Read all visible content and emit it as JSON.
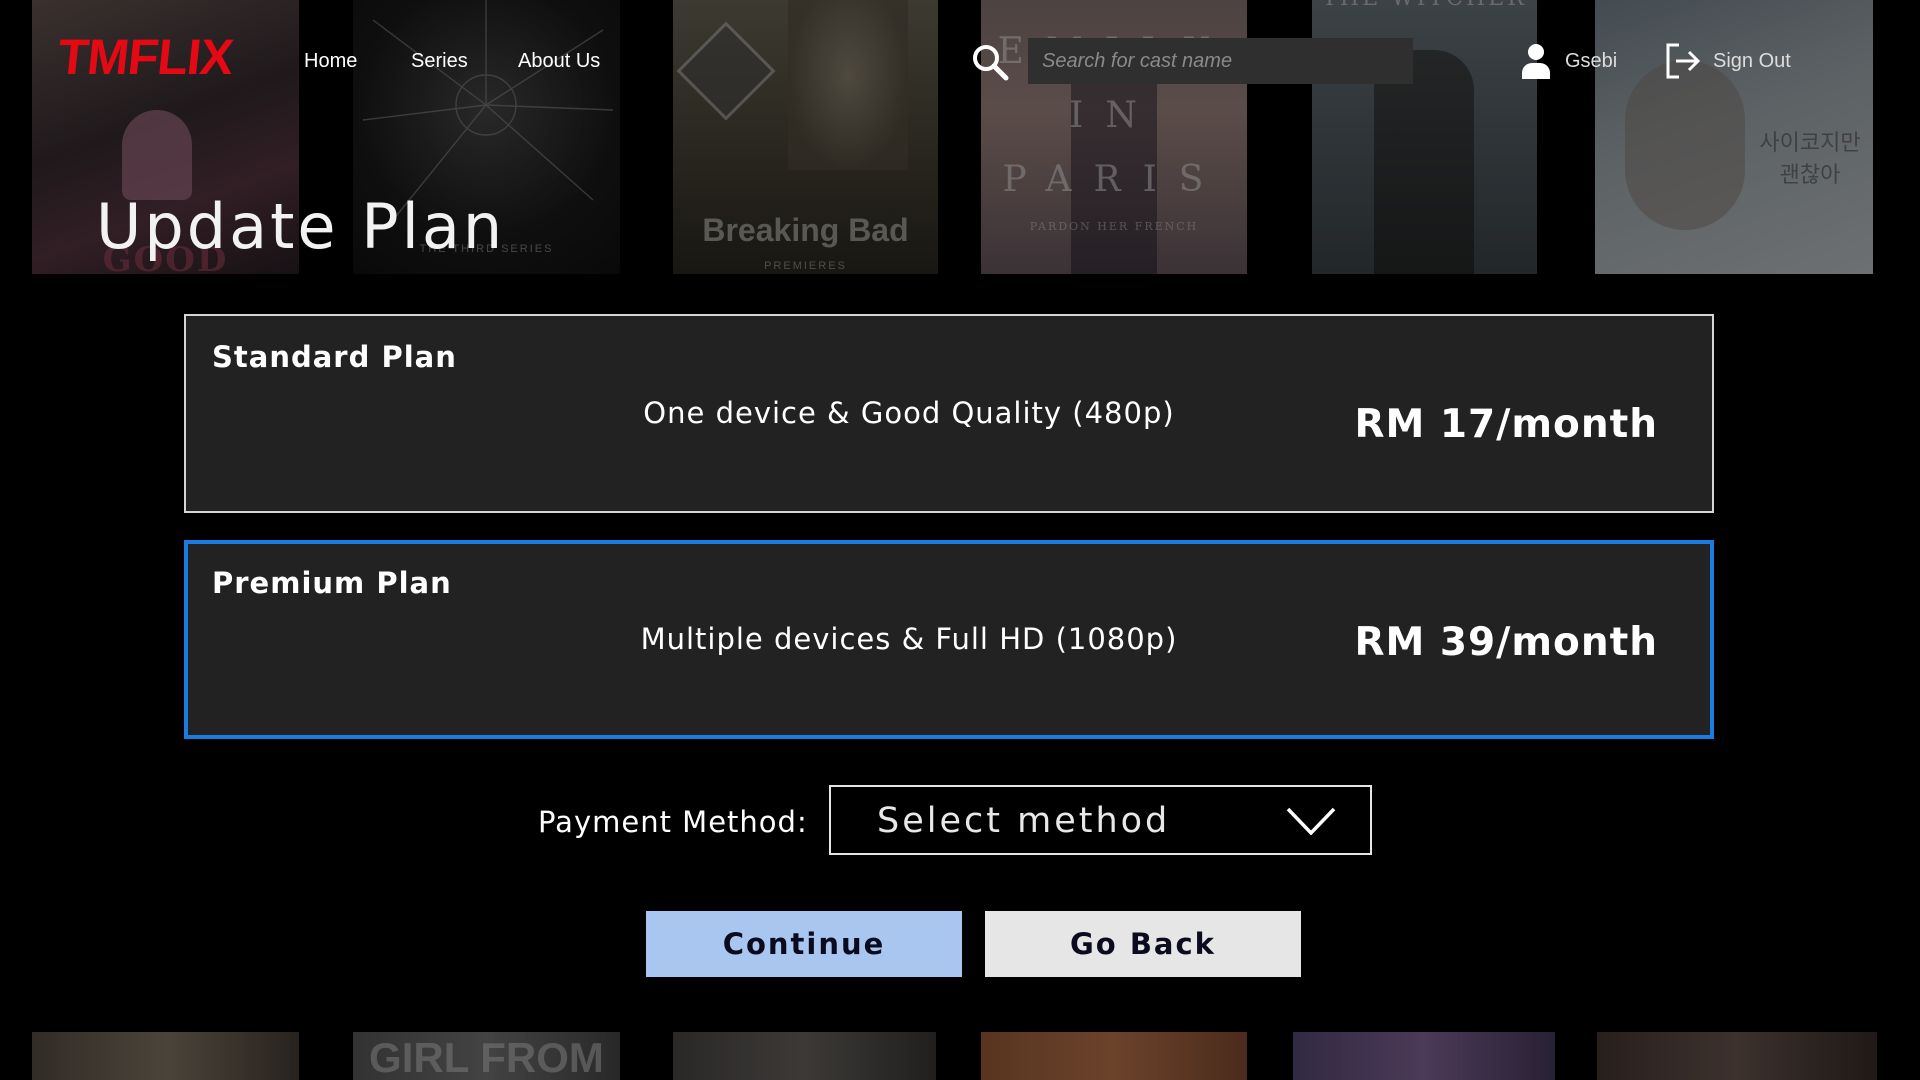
{
  "header": {
    "logo": "TMFLIX",
    "nav": [
      "Home",
      "Series",
      "About Us"
    ],
    "search_placeholder": "Search for cast name",
    "user_name": "Gsebi",
    "sign_out": "Sign Out"
  },
  "page_title": "Update Plan",
  "posters_top": [
    {
      "title": "GOOD GIRLS",
      "sub": ""
    },
    {
      "title": "",
      "sub": "THE THIRD SERIES"
    },
    {
      "title": "Breaking Bad",
      "sub": "PREMIERES"
    },
    {
      "title": "EMILY IN PARIS",
      "sub": "PARDON HER FRENCH"
    },
    {
      "title": "THE WITCHER",
      "sub": ""
    },
    {
      "title": "사이코지만 괜찮아",
      "sub": ""
    }
  ],
  "posters_bottom": [
    {
      "title": ""
    },
    {
      "title": "GIRL FROM"
    },
    {
      "title": ""
    },
    {
      "title": ""
    },
    {
      "title": ""
    },
    {
      "title": ""
    }
  ],
  "plans": [
    {
      "name": "Standard Plan",
      "description": "One device & Good Quality (480p)",
      "price": "RM 17/month",
      "selected": false
    },
    {
      "name": "Premium Plan",
      "description": "Multiple devices & Full HD (1080p)",
      "price": "RM 39/month",
      "selected": true
    }
  ],
  "payment": {
    "label": "Payment Method:",
    "selected": "Select method"
  },
  "buttons": {
    "continue": "Continue",
    "back": "Go Back"
  },
  "colors": {
    "logo": "#e50914",
    "selected_border": "#1a7ce0",
    "card_bg": "#222222",
    "continue_bg": "#a8c6ef",
    "back_bg": "#e6e6e6"
  }
}
